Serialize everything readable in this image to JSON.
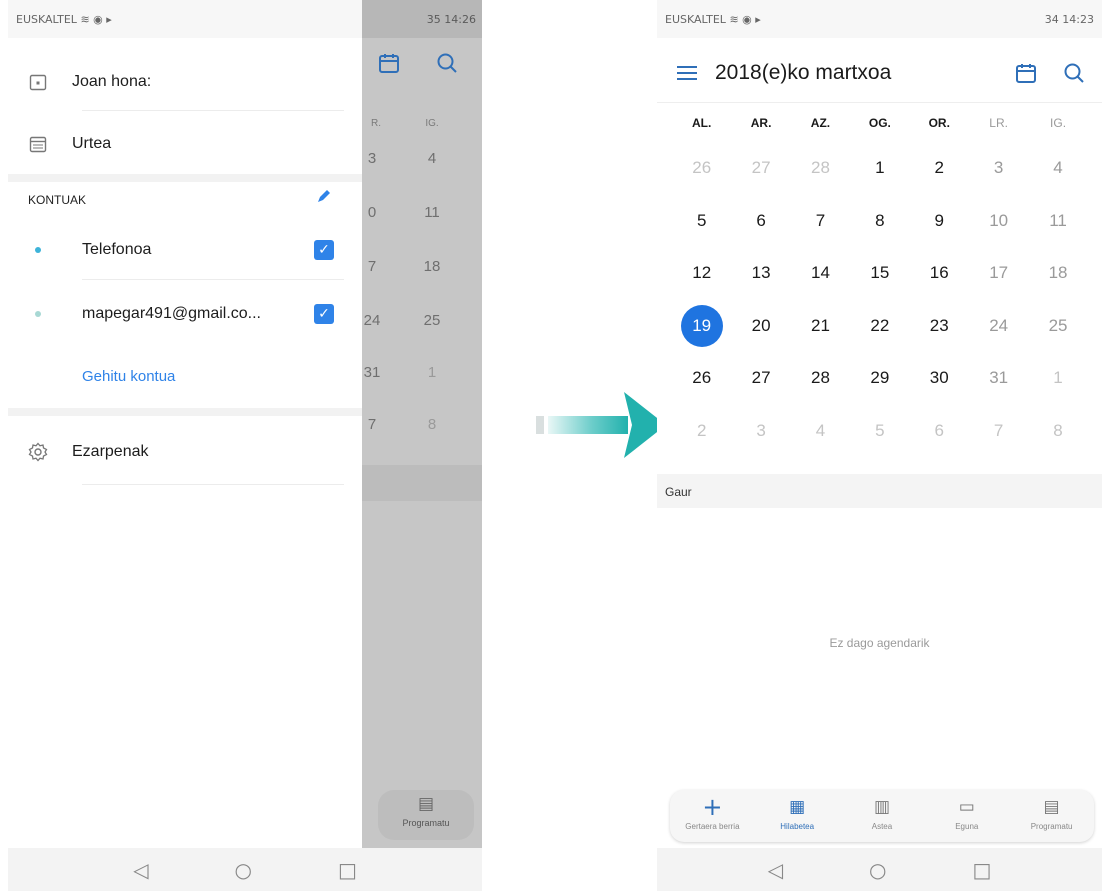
{
  "left": {
    "status": {
      "carrier": "EUSKALTEL",
      "indicators": "≋ ◉ ▸",
      "right": "35 14:26"
    },
    "drawer": {
      "go_today": "Joan hona:",
      "year": "Urtea",
      "accounts_header": "KONTUAK",
      "accounts": [
        {
          "label": "Telefonoa",
          "checked": true
        },
        {
          "label": "mapegar491@gmail.co...",
          "checked": true
        }
      ],
      "add_account": "Gehitu kontua",
      "settings": "Ezarpenak"
    },
    "behind": {
      "headers": [
        "R.",
        "IG."
      ],
      "days": [
        [
          "3",
          "4"
        ],
        [
          "0",
          "11"
        ],
        [
          "7",
          "18"
        ],
        [
          "24",
          "25"
        ],
        [
          "31",
          "1"
        ],
        [
          "7",
          "8"
        ]
      ],
      "fab_label": "Programatu"
    }
  },
  "right": {
    "status": {
      "carrier": "EUSKALTEL",
      "indicators": "≋ ◉ ▸",
      "right": "34 14:23"
    },
    "title": "2018(e)ko martxoa",
    "weekdays": [
      "AL.",
      "AR.",
      "AZ.",
      "OG.",
      "OR.",
      "LR.",
      "IG."
    ],
    "weeks": [
      [
        "26",
        "27",
        "28",
        "1",
        "2",
        "3",
        "4"
      ],
      [
        "5",
        "6",
        "7",
        "8",
        "9",
        "10",
        "11"
      ],
      [
        "12",
        "13",
        "14",
        "15",
        "16",
        "17",
        "18"
      ],
      [
        "19",
        "20",
        "21",
        "22",
        "23",
        "24",
        "25"
      ],
      [
        "26",
        "27",
        "28",
        "29",
        "30",
        "31",
        "1"
      ],
      [
        "2",
        "3",
        "4",
        "5",
        "6",
        "7",
        "8"
      ]
    ],
    "today": "19",
    "today_section": "Gaur",
    "empty_message": "Ez dago agendarik",
    "tabs": [
      {
        "label": "Gertaera berria",
        "icon": "plus-icon"
      },
      {
        "label": "Hilabetea",
        "icon": "month-grid-icon"
      },
      {
        "label": "Astea",
        "icon": "week-icon"
      },
      {
        "label": "Eguna",
        "icon": "day-icon"
      },
      {
        "label": "Programatu",
        "icon": "agenda-icon"
      }
    ]
  },
  "colors": {
    "accent": "#1f74e0",
    "arrow": "#2ab3b0"
  }
}
